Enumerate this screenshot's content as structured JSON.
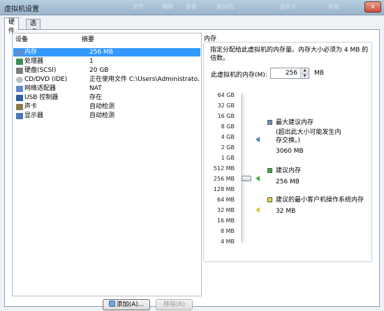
{
  "window": {
    "title": "虚拟机设置",
    "background_titles": [
      "文件",
      "编辑",
      "查看",
      "虚拟机",
      "选项卡",
      "帮助"
    ],
    "close_label": "x"
  },
  "tabs": [
    {
      "label": "硬件",
      "active": true
    },
    {
      "label": "选项",
      "active": false
    }
  ],
  "device_list": {
    "header_device": "设备",
    "header_summary": "摘要",
    "items": [
      {
        "name": "内存",
        "summary": "256 MB",
        "icon": "memory-icon",
        "color": "#5b8fd1",
        "selected": true
      },
      {
        "name": "处理器",
        "summary": "1",
        "icon": "cpu-icon",
        "color": "#3d8b57",
        "selected": false
      },
      {
        "name": "硬盘(SCSI)",
        "summary": "20 GB",
        "icon": "harddisk-icon",
        "color": "#7d7d7d",
        "selected": false
      },
      {
        "name": "CD/DVD (IDE)",
        "summary": "正在使用文件 C:\\Users\\Administrato...",
        "icon": "cd-dvd-icon",
        "color": "#b9c2cc",
        "selected": false
      },
      {
        "name": "网络适配器",
        "summary": "NAT",
        "icon": "network-adapter-icon",
        "color": "#5f88c9",
        "selected": false
      },
      {
        "name": "USB 控制器",
        "summary": "存在",
        "icon": "usb-icon",
        "color": "#2f5f9e",
        "selected": false
      },
      {
        "name": "声卡",
        "summary": "自动检测",
        "icon": "sound-card-icon",
        "color": "#8c7b4a",
        "selected": false
      },
      {
        "name": "显示器",
        "summary": "自动检测",
        "icon": "display-icon",
        "color": "#4a78b8",
        "selected": false
      }
    ],
    "add_button": "添加(A)...",
    "remove_button": "移除(R)"
  },
  "memory": {
    "section_title": "内存",
    "description": "指定分配给此虚拟机的内存量。内存大小必须为 4 MB 的倍数。",
    "field_label": "此虚拟机的内存(M):",
    "value": "256",
    "unit": "MB",
    "scale_labels": [
      "64 GB",
      "32 GB",
      "16 GB",
      "8 GB",
      "4 GB",
      "2 GB",
      "1 GB",
      "512 MB",
      "256 MB",
      "128 MB",
      "64 MB",
      "32 MB",
      "16 MB",
      "8 MB",
      "4 MB"
    ],
    "legend": [
      {
        "title": "最大建议内存",
        "note": "(超出此大小可能发生内存交换。)",
        "value": "3060 MB",
        "color": "#6d90c4",
        "marker_color": "#4f7fc4"
      },
      {
        "title": "建议内存",
        "note": "",
        "value": "256 MB",
        "color": "#3fae3f",
        "marker_color": "#3fae3f"
      },
      {
        "title": "建议的最小客户机操作系统内存",
        "note": "",
        "value": "32 MB",
        "color": "#e6d840",
        "marker_color": "#d9c930"
      }
    ]
  }
}
